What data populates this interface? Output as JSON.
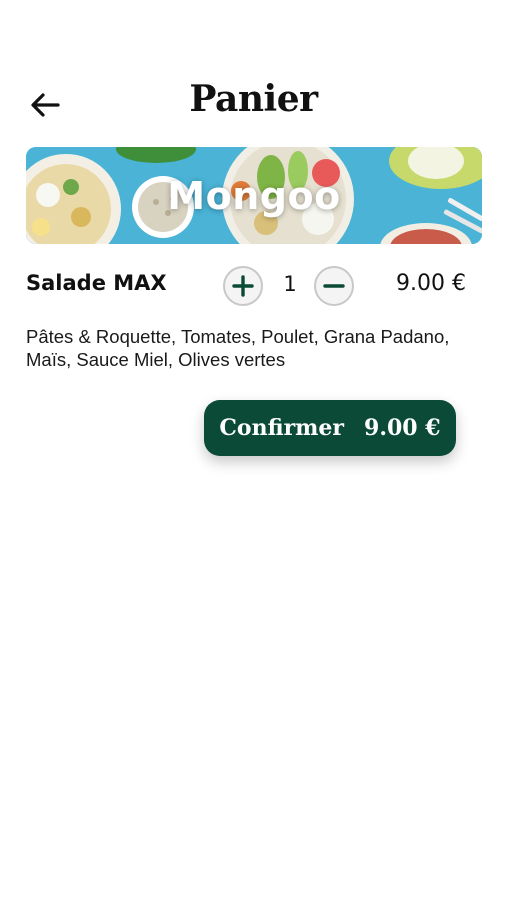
{
  "header": {
    "title": "Panier",
    "back_icon": "arrow-left-icon"
  },
  "restaurant": {
    "name": "Mongoo",
    "banner_image": "salad-bowls-banner"
  },
  "cart": {
    "items": [
      {
        "name": "Salade MAX",
        "quantity": "1",
        "price": "9.00 €",
        "description": "Pâtes & Roquette, Tomates, Poulet, Grana Padano, Maïs, Sauce Miel, Olives vertes"
      }
    ]
  },
  "confirm": {
    "label": "Confirmer",
    "total": "9.00 €"
  },
  "colors": {
    "accent": "#0b4a36",
    "banner_background": "#4ab3d6",
    "button_border": "#c8c8c8"
  }
}
